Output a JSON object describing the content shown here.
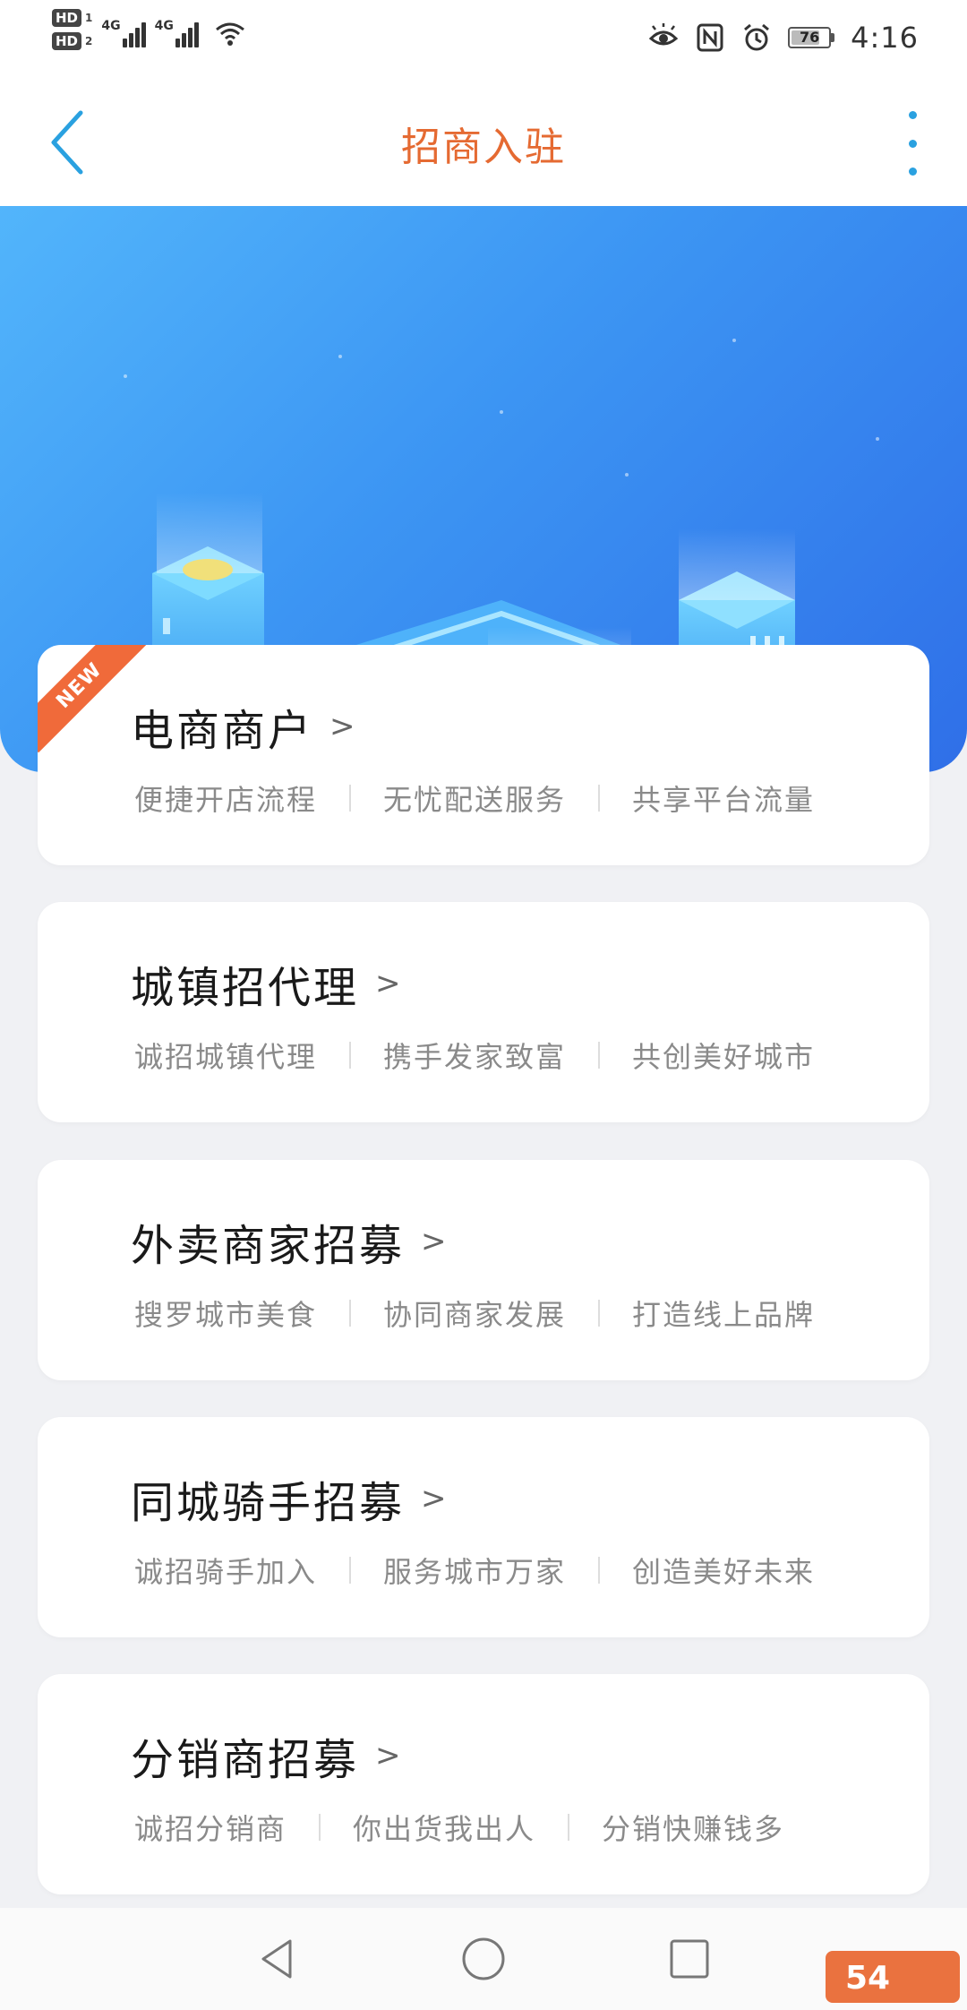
{
  "status_bar": {
    "hd1": "HD",
    "hd1_num": "1",
    "hd2": "HD",
    "hd2_num": "2",
    "net1": "4G",
    "net2": "4G",
    "battery": "76",
    "time": "4:16"
  },
  "header": {
    "title": "招商入驻"
  },
  "cards": [
    {
      "title": "电商商户",
      "tags": [
        "便捷开店流程",
        "无忧配送服务",
        "共享平台流量"
      ],
      "badge": "NEW"
    },
    {
      "title": "城镇招代理",
      "tags": [
        "诚招城镇代理",
        "携手发家致富",
        "共创美好城市"
      ]
    },
    {
      "title": "外卖商家招募",
      "tags": [
        "搜罗城市美食",
        "协同商家发展",
        "打造线上品牌"
      ]
    },
    {
      "title": "同城骑手招募",
      "tags": [
        "诚招骑手加入",
        "服务城市万家",
        "创造美好未来"
      ]
    },
    {
      "title": "分销商招募",
      "tags": [
        "诚招分销商",
        "你出货我出人",
        "分销快赚钱多"
      ]
    }
  ],
  "colors": {
    "title": "#e56a32",
    "accent": "#2aa1e0",
    "banner_start": "#52b5fb",
    "banner_end": "#2f6fe8",
    "badge": "#f06a3a"
  },
  "watermark": "54"
}
